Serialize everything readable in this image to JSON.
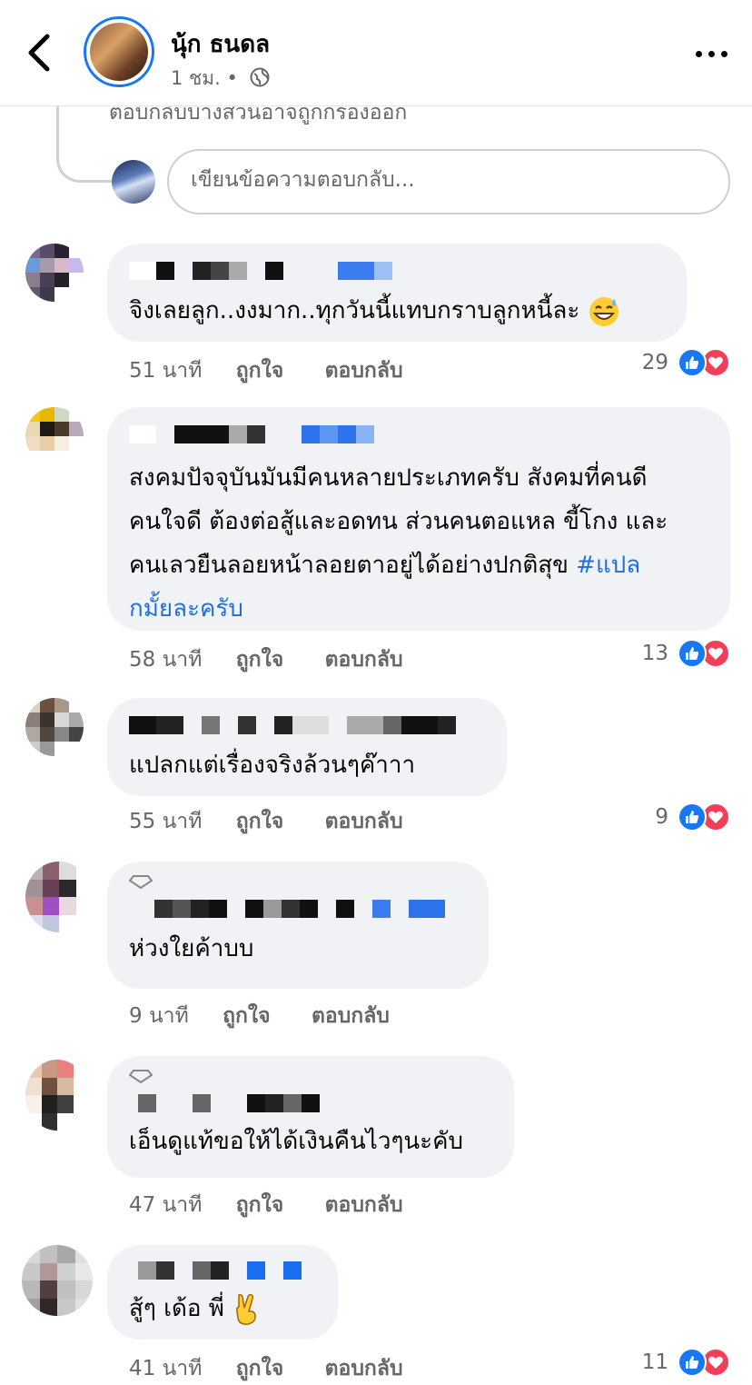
{
  "header": {
    "name": "นุ้ก ธนดล",
    "time": "1 ชม.",
    "separator": "•"
  },
  "thread": {
    "filtered_notice": "ตอบกลับบางส่วนอาจถูกกรองออก",
    "reply_placeholder": "เขียนข้อความตอบกลับ..."
  },
  "labels": {
    "like": "ถูกใจ",
    "reply": "ตอบกลับ"
  },
  "colors": {
    "link": "#216fdb",
    "like": "#1877f2",
    "love": "#f33e58",
    "bubble": "#f0f2f5"
  },
  "comments": [
    {
      "time": "51 นาที",
      "text": "จิงเลยลูก..งงมาก..ทุกวันนี้แทบกราบลูกหนี้ละ",
      "emoji": "sweat-smile-emoji",
      "reactions": "29"
    },
    {
      "time": "58 นาที",
      "text": "สงคมปัจจุบันมันมีคนหลายประเภทครับ สังคมที่คนดี\nคนใจดี ต้องต่อสู้และอดทน ส่วนคนตอแหล ขี้โกง และ\nคนเลวยืนลอยหน้าลอยตาอยู่ได้อย่างปกติสุข ",
      "hashtag": "#แปล\nกมั้ยละครับ",
      "reactions": "13"
    },
    {
      "time": "55 นาที",
      "text": "แปลกแต่เรื่องจริงล้วนๆค๊าาา",
      "reactions": "9"
    },
    {
      "time": "9 นาที",
      "text": "ห่วงใยค้าบบ",
      "reactions": ""
    },
    {
      "time": "47 นาที",
      "text": "เอ็นดูแท้ขอให้ได้เงินคืนไวๆนะคับ",
      "reactions": ""
    },
    {
      "time": "41 นาที",
      "text": "สู้ๆ เด้อ พี่",
      "emoji": "victory-hand-emoji",
      "reactions": "11"
    }
  ]
}
